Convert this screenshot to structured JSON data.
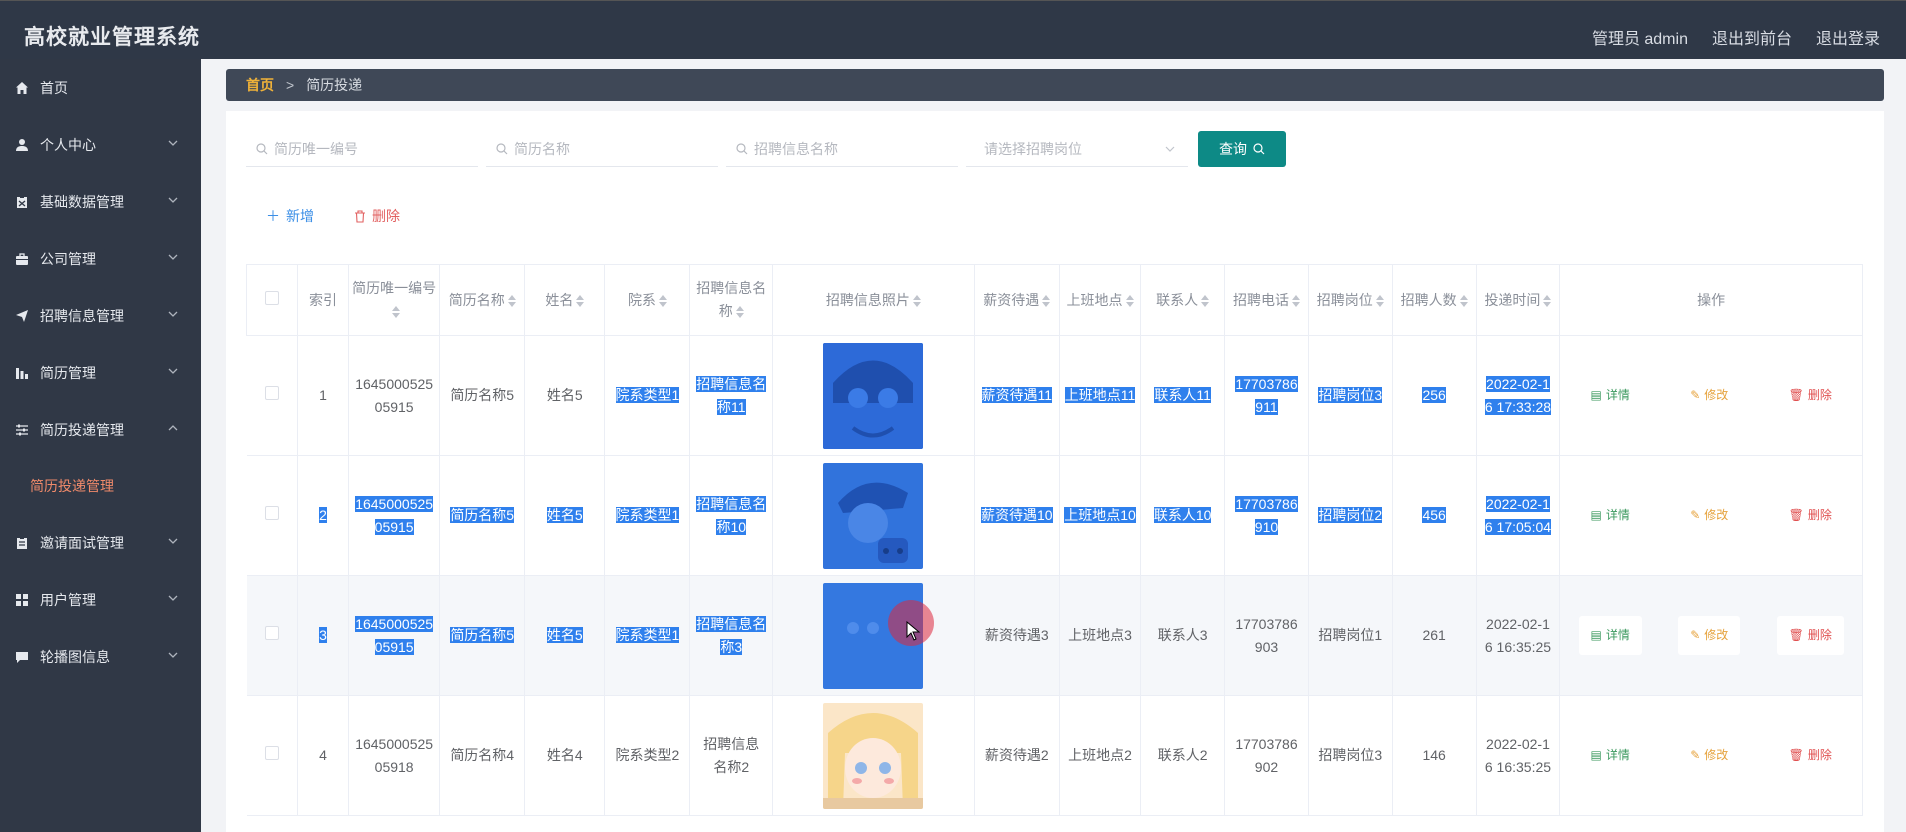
{
  "header": {
    "title": "高校就业管理系统",
    "user": "管理员 admin",
    "to_front": "退出到前台",
    "logout": "退出登录"
  },
  "sidebar": {
    "items": [
      {
        "label": "首页",
        "icon": "home-icon"
      },
      {
        "label": "个人中心",
        "icon": "user-icon"
      },
      {
        "label": "基础数据管理",
        "icon": "clipboard-icon"
      },
      {
        "label": "公司管理",
        "icon": "briefcase-icon"
      },
      {
        "label": "招聘信息管理",
        "icon": "send-icon"
      },
      {
        "label": "简历管理",
        "icon": "bar-chart-icon"
      },
      {
        "label": "简历投递管理",
        "icon": "sliders-icon"
      },
      {
        "label": "邀请面试管理",
        "icon": "clipboard-icon"
      },
      {
        "label": "用户管理",
        "icon": "grid-icon"
      },
      {
        "label": "轮播图信息",
        "icon": "chat-icon"
      }
    ],
    "active_sub": "简历投递管理"
  },
  "breadcrumb": {
    "home": "首页",
    "sep": ">",
    "current": "简历投递"
  },
  "search": {
    "resume_id_placeholder": "简历唯一编号",
    "resume_name_placeholder": "简历名称",
    "job_name_placeholder": "招聘信息名称",
    "position_placeholder": "请选择招聘岗位",
    "query_label": "查询"
  },
  "actions": {
    "add": "新增",
    "delete": "删除"
  },
  "table": {
    "headers": {
      "index": "索引",
      "resume_id": "简历唯一编号",
      "resume_name": "简历名称",
      "name": "姓名",
      "dept": "院系",
      "job_name": "招聘信息名称",
      "photo": "招聘信息照片",
      "salary": "薪资待遇",
      "location": "上班地点",
      "contact": "联系人",
      "phone": "招聘电话",
      "position": "招聘岗位",
      "count": "招聘人数",
      "time": "投递时间",
      "ops": "操作"
    },
    "rows": [
      {
        "index": "1",
        "resume_id": "164500052505915",
        "resume_name": "简历名称5",
        "name": "姓名5",
        "dept": "院系类型1",
        "job_name": "招聘信息名称11",
        "salary": "薪资待遇11",
        "location": "上班地点11",
        "contact": "联系人11",
        "phone": "17703786911",
        "position": "招聘岗位3",
        "count": "256",
        "time": "2022-02-16 17:33:28"
      },
      {
        "index": "2",
        "resume_id": "164500052505915",
        "resume_name": "简历名称5",
        "name": "姓名5",
        "dept": "院系类型1",
        "job_name": "招聘信息名称10",
        "salary": "薪资待遇10",
        "location": "上班地点10",
        "contact": "联系人10",
        "phone": "17703786910",
        "position": "招聘岗位2",
        "count": "456",
        "time": "2022-02-16 17:05:04"
      },
      {
        "index": "3",
        "resume_id": "164500052505915",
        "resume_name": "简历名称5",
        "name": "姓名5",
        "dept": "院系类型1",
        "job_name": "招聘信息名称3",
        "salary": "薪资待遇3",
        "location": "上班地点3",
        "contact": "联系人3",
        "phone": "17703786903",
        "position": "招聘岗位1",
        "count": "261",
        "time": "2022-02-16 16:35:25"
      },
      {
        "index": "4",
        "resume_id": "164500052505918",
        "resume_name": "简历名称4",
        "name": "姓名4",
        "dept": "院系类型2",
        "job_name": "招聘信息名称2",
        "salary": "薪资待遇2",
        "location": "上班地点2",
        "contact": "联系人2",
        "phone": "17703786902",
        "position": "招聘岗位3",
        "count": "146",
        "time": "2022-02-16 16:35:25"
      }
    ],
    "op_labels": {
      "detail": "详情",
      "edit": "修改",
      "del": "删除"
    }
  },
  "colors": {
    "accent": "#0d8a86",
    "header_bg": "#2f3847",
    "sidebar_bg": "#303846",
    "selection": "#2f80ed"
  }
}
